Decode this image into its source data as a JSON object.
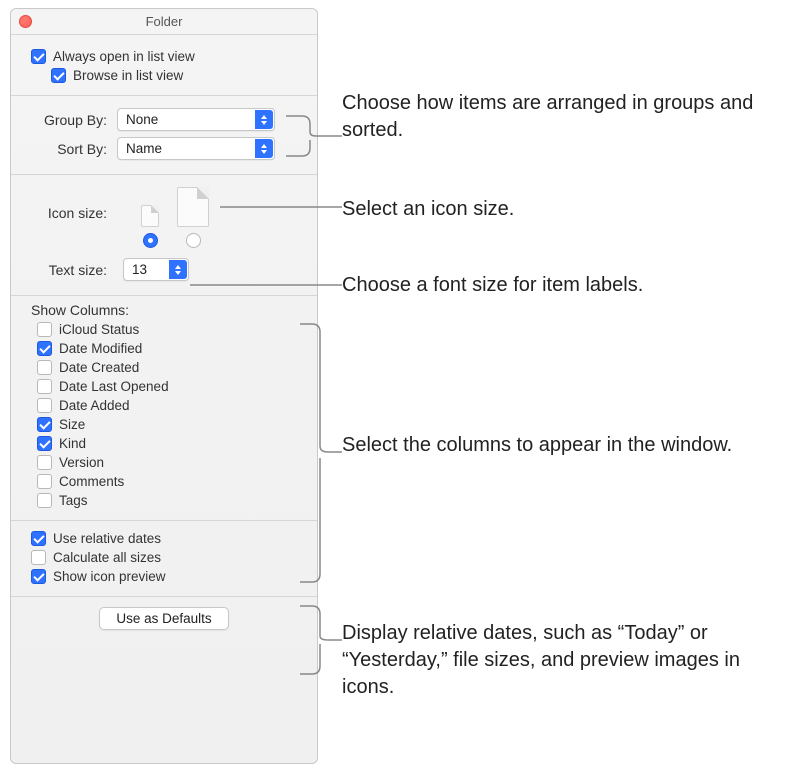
{
  "window": {
    "title": "Folder"
  },
  "top_checks": {
    "always_open": {
      "label": "Always open in list view",
      "checked": true
    },
    "browse": {
      "label": "Browse in list view",
      "checked": true
    }
  },
  "sorting": {
    "group_by_label": "Group By:",
    "group_by_value": "None",
    "sort_by_label": "Sort By:",
    "sort_by_value": "Name"
  },
  "icon_size": {
    "label": "Icon size:",
    "selected": "small"
  },
  "text_size": {
    "label": "Text size:",
    "value": "13"
  },
  "columns": {
    "header": "Show Columns:",
    "items": [
      {
        "label": "iCloud Status",
        "checked": false
      },
      {
        "label": "Date Modified",
        "checked": true
      },
      {
        "label": "Date Created",
        "checked": false
      },
      {
        "label": "Date Last Opened",
        "checked": false
      },
      {
        "label": "Date Added",
        "checked": false
      },
      {
        "label": "Size",
        "checked": true
      },
      {
        "label": "Kind",
        "checked": true
      },
      {
        "label": "Version",
        "checked": false
      },
      {
        "label": "Comments",
        "checked": false
      },
      {
        "label": "Tags",
        "checked": false
      }
    ]
  },
  "misc": {
    "relative_dates": {
      "label": "Use relative dates",
      "checked": true
    },
    "calculate_sizes": {
      "label": "Calculate all sizes",
      "checked": false
    },
    "icon_preview": {
      "label": "Show icon preview",
      "checked": true
    }
  },
  "defaults_button": "Use as Defaults",
  "callouts": {
    "sorting": "Choose how items are arranged in groups and sorted.",
    "icon_size": "Select an icon size.",
    "text_size": "Choose a font size for item labels.",
    "columns": "Select the columns to appear in the window.",
    "misc": "Display relative dates, such as “Today” or “Yesterday,” file sizes, and preview images in icons."
  }
}
